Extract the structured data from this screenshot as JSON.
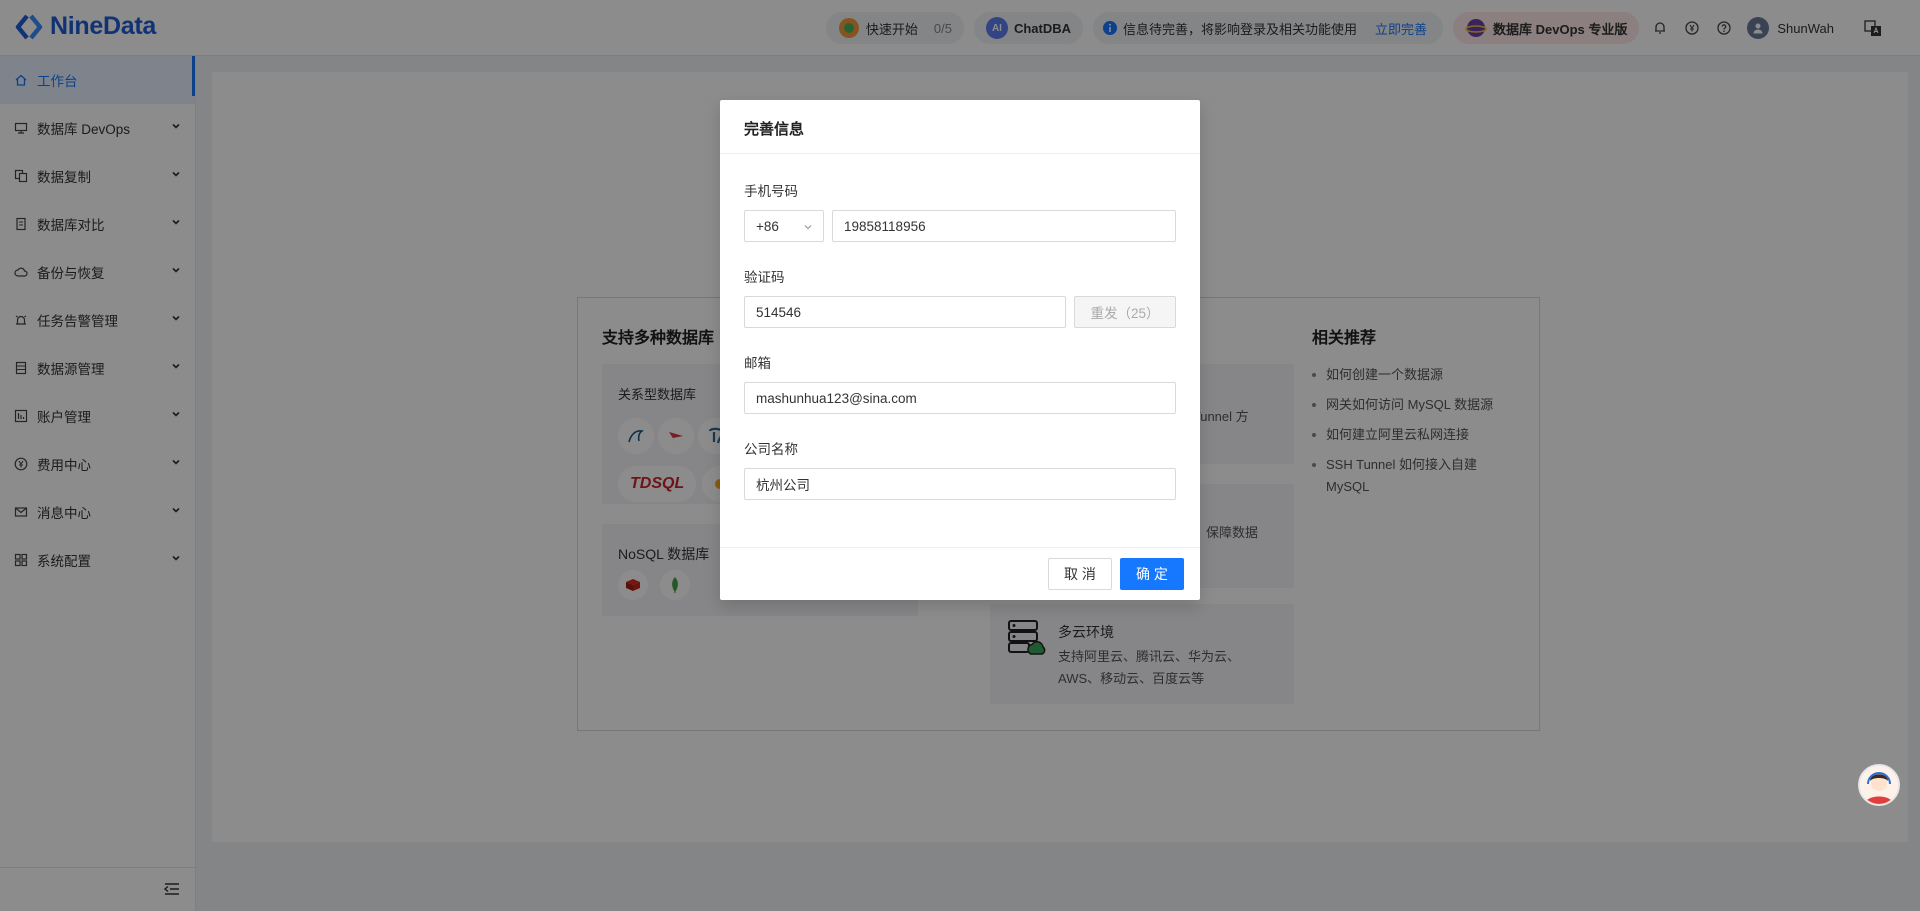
{
  "app": {
    "name": "NineData"
  },
  "header": {
    "quick_start": {
      "label": "快速开始",
      "progress": "0/5"
    },
    "chatdba": {
      "badge": "AI",
      "label": "ChatDBA"
    },
    "notice": {
      "text": "信息待完善，将影响登录及相关功能使用",
      "link": "立即完善"
    },
    "plan": {
      "label": "数据库 DevOps 专业版"
    },
    "user": {
      "name": "ShunWah"
    },
    "colors": {
      "brand": "#1f5bd6",
      "accent": "#1677ff"
    }
  },
  "sidebar": {
    "items": [
      {
        "label": "工作台",
        "icon": "home-icon",
        "active": true
      },
      {
        "label": "数据库 DevOps",
        "icon": "monitor-icon"
      },
      {
        "label": "数据复制",
        "icon": "copy-icon"
      },
      {
        "label": "数据库对比",
        "icon": "compare-icon"
      },
      {
        "label": "备份与恢复",
        "icon": "cloud-icon"
      },
      {
        "label": "任务告警管理",
        "icon": "alarm-icon"
      },
      {
        "label": "数据源管理",
        "icon": "datasource-icon"
      },
      {
        "label": "账户管理",
        "icon": "account-icon"
      },
      {
        "label": "费用中心",
        "icon": "yen-icon"
      },
      {
        "label": "消息中心",
        "icon": "mail-icon"
      },
      {
        "label": "系统配置",
        "icon": "grid-icon"
      }
    ]
  },
  "main": {
    "db_section": {
      "title": "支持多种数据库",
      "relational": {
        "title": "关系型数据库",
        "chip": "TDSQL"
      },
      "nosql": {
        "title": "NoSQL 数据库"
      }
    },
    "features": {
      "tunnel_fragment": "H Tunnel 方",
      "secure_fragment": "接，保障数据",
      "multicloud": {
        "title": "多云环境",
        "desc": "支持阿里云、腾讯云、华为云、AWS、移动云、百度云等"
      }
    },
    "recommend": {
      "title": "相关推荐",
      "items": [
        "如何创建一个数据源",
        "网关如何访问 MySQL 数据源",
        "如何建立阿里云私网连接",
        "SSH Tunnel 如何接入自建 MySQL"
      ]
    }
  },
  "modal": {
    "title": "完善信息",
    "phone": {
      "label": "手机号码",
      "country_code": "+86",
      "value": "19858118956"
    },
    "code": {
      "label": "验证码",
      "value": "514546",
      "resend": "重发（25）"
    },
    "email": {
      "label": "邮箱",
      "value": "mashunhua123@sina.com"
    },
    "company": {
      "label": "公司名称",
      "value": "杭州公司"
    },
    "cancel": "取 消",
    "confirm": "确 定"
  }
}
